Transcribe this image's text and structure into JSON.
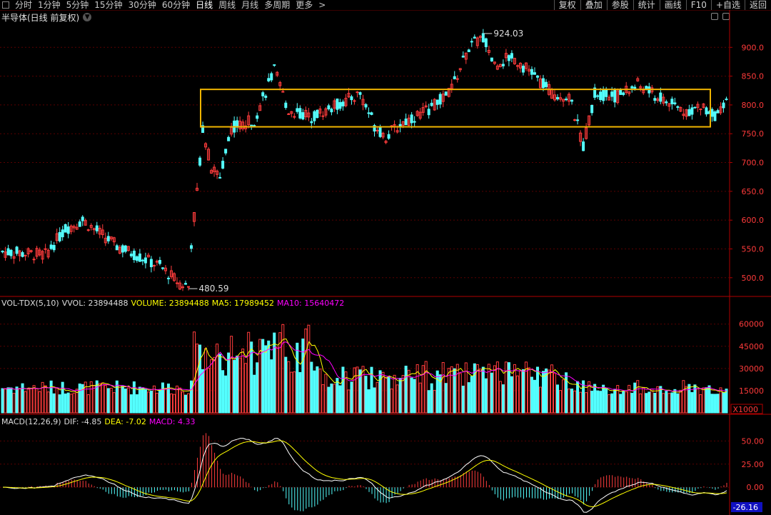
{
  "toolbar": {
    "tabs": [
      "分时",
      "1分钟",
      "5分钟",
      "15分钟",
      "30分钟",
      "60分钟",
      "日线",
      "周线",
      "月线",
      "多周期",
      "更多"
    ],
    "active_tab": "日线",
    "more_icon": "chevron-right-icon",
    "right_buttons": [
      "复权",
      "叠加",
      "参股",
      "统计",
      "画线",
      "F10",
      "+自选",
      "返回"
    ]
  },
  "chart_title": "半导体(日线 前复权)",
  "colors": {
    "up": "#ff3c3c",
    "down": "#54ffff",
    "ma5": "#ffff00",
    "ma10": "#ff00ff",
    "axis": "#b00000",
    "box": "#f0b400"
  },
  "price_panel": {
    "y_ticks": [
      "900.0",
      "850.0",
      "800.0",
      "750.0",
      "700.0",
      "650.0",
      "600.0",
      "550.0",
      "500.0"
    ],
    "high_label": "924.03",
    "low_label": "480.59"
  },
  "volume_panel": {
    "indicator": "VOL-TDX(5,10)",
    "vvol": "VVOL: 23894488",
    "volume": "VOLUME: 23894488",
    "ma5": "MA5: 17989452",
    "ma10": "MA10: 15640472",
    "y_ticks": [
      "60000",
      "45000",
      "30000",
      "15000"
    ],
    "unit": "X1000"
  },
  "macd_panel": {
    "indicator": "MACD(12,26,9)",
    "dif": "DIF: -4.85",
    "dea": "DEA: -7.02",
    "macd": "MACD: 4.33",
    "y_ticks": [
      "50.00",
      "25.00",
      "0.00"
    ],
    "current_value": "-26.16"
  },
  "chart_data": {
    "type": "candlestick",
    "series": [
      {
        "name": "price",
        "x_count": 170,
        "ylim": [
          470,
          945
        ]
      },
      {
        "name": "volume",
        "ylim": [
          0,
          70000
        ]
      },
      {
        "name": "macd",
        "ylim": [
          -30,
          65
        ]
      }
    ],
    "keypoints": {
      "open": 560,
      "trough": 480.59,
      "peak": 924.03,
      "last": 800
    }
  }
}
